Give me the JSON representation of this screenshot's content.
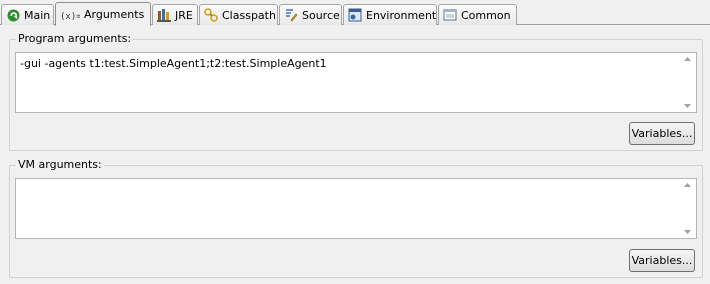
{
  "tabs": [
    {
      "label": "Main",
      "icon": "main-run-icon",
      "active": false
    },
    {
      "label": "Arguments",
      "icon": "arguments-icon",
      "active": true
    },
    {
      "label": "JRE",
      "icon": "jre-library-icon",
      "active": false
    },
    {
      "label": "Classpath",
      "icon": "classpath-icon",
      "active": false
    },
    {
      "label": "Source",
      "icon": "source-icon",
      "active": false
    },
    {
      "label": "Environment",
      "icon": "environment-icon",
      "active": false
    },
    {
      "label": "Common",
      "icon": "common-icon",
      "active": false
    }
  ],
  "program_arguments": {
    "title": "Program arguments:",
    "value": "-gui -agents t1:test.SimpleAgent1;t2:test.SimpleAgent1",
    "button_label": "Variables..."
  },
  "vm_arguments": {
    "title": "VM arguments:",
    "value": "",
    "button_label": "Variables..."
  },
  "colors": {
    "background": "#f0f0f0",
    "main_icon_green": "#2e8b2e",
    "jre_icon_brown": "#8b5a2b",
    "classpath_icon_yellow": "#d4a017"
  }
}
